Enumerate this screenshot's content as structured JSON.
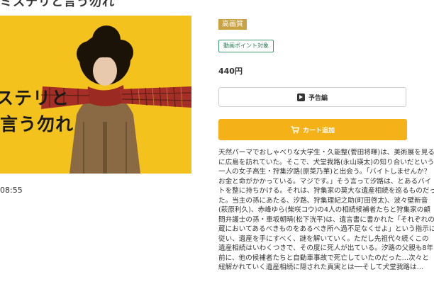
{
  "header": {
    "title": "ミステリと言う勿れ"
  },
  "poster": {
    "line1": "ステリと",
    "line2": "言う勿れ"
  },
  "duration": "08:55",
  "badges": {
    "quality": "高画質",
    "point": "動画ポイント対象"
  },
  "price": "440円",
  "buttons": {
    "trailer": "予告編",
    "cart": "カート追加"
  },
  "description": [
    "天然パーマでおしゃべりな大学生・久能整(菅田将暉)は、美術展を見るため",
    "に広島を訪れていた。そこで、犬堂我路(永山瑛太)の知り合いだという",
    "一人の女子高生・狩集汐路(原菜乃華)と出会う。「バイトしませんか？",
    "お金と命がかかっている。マジです。」そう言って汐路は、とあるバイ",
    "トを整に持ちかける。それは、狩集家の莫大な遺産相続を巡るものだっ",
    "た。当主の孫にあたる、汐路、狩集理紀之助(町田啓太)、波々壁新音",
    "(萩原利久)、赤峰ゆら(柴咲コウ)の4人の相続候補者たちと狩集家の顧",
    "問弁護士の孫・車坂朝晴(松下洸平)は、遺言書に書かれた「それぞれの",
    "蔵においてあるべきものをあるべき所へ過不足なくせよ」という指示に",
    "従い、遺産を手にすべく、謎を解いていく。ただし先祖代々続くこの",
    "遺産相続はいわくつきで、その度に死人が出ている。汐路の父親も8年",
    "前に、他の候補者たちと自動車事故で死亡していたのだった…次々と",
    "紐解かれていく遺産相続に隠された真実とは──そして犬堂我路は…"
  ]
}
